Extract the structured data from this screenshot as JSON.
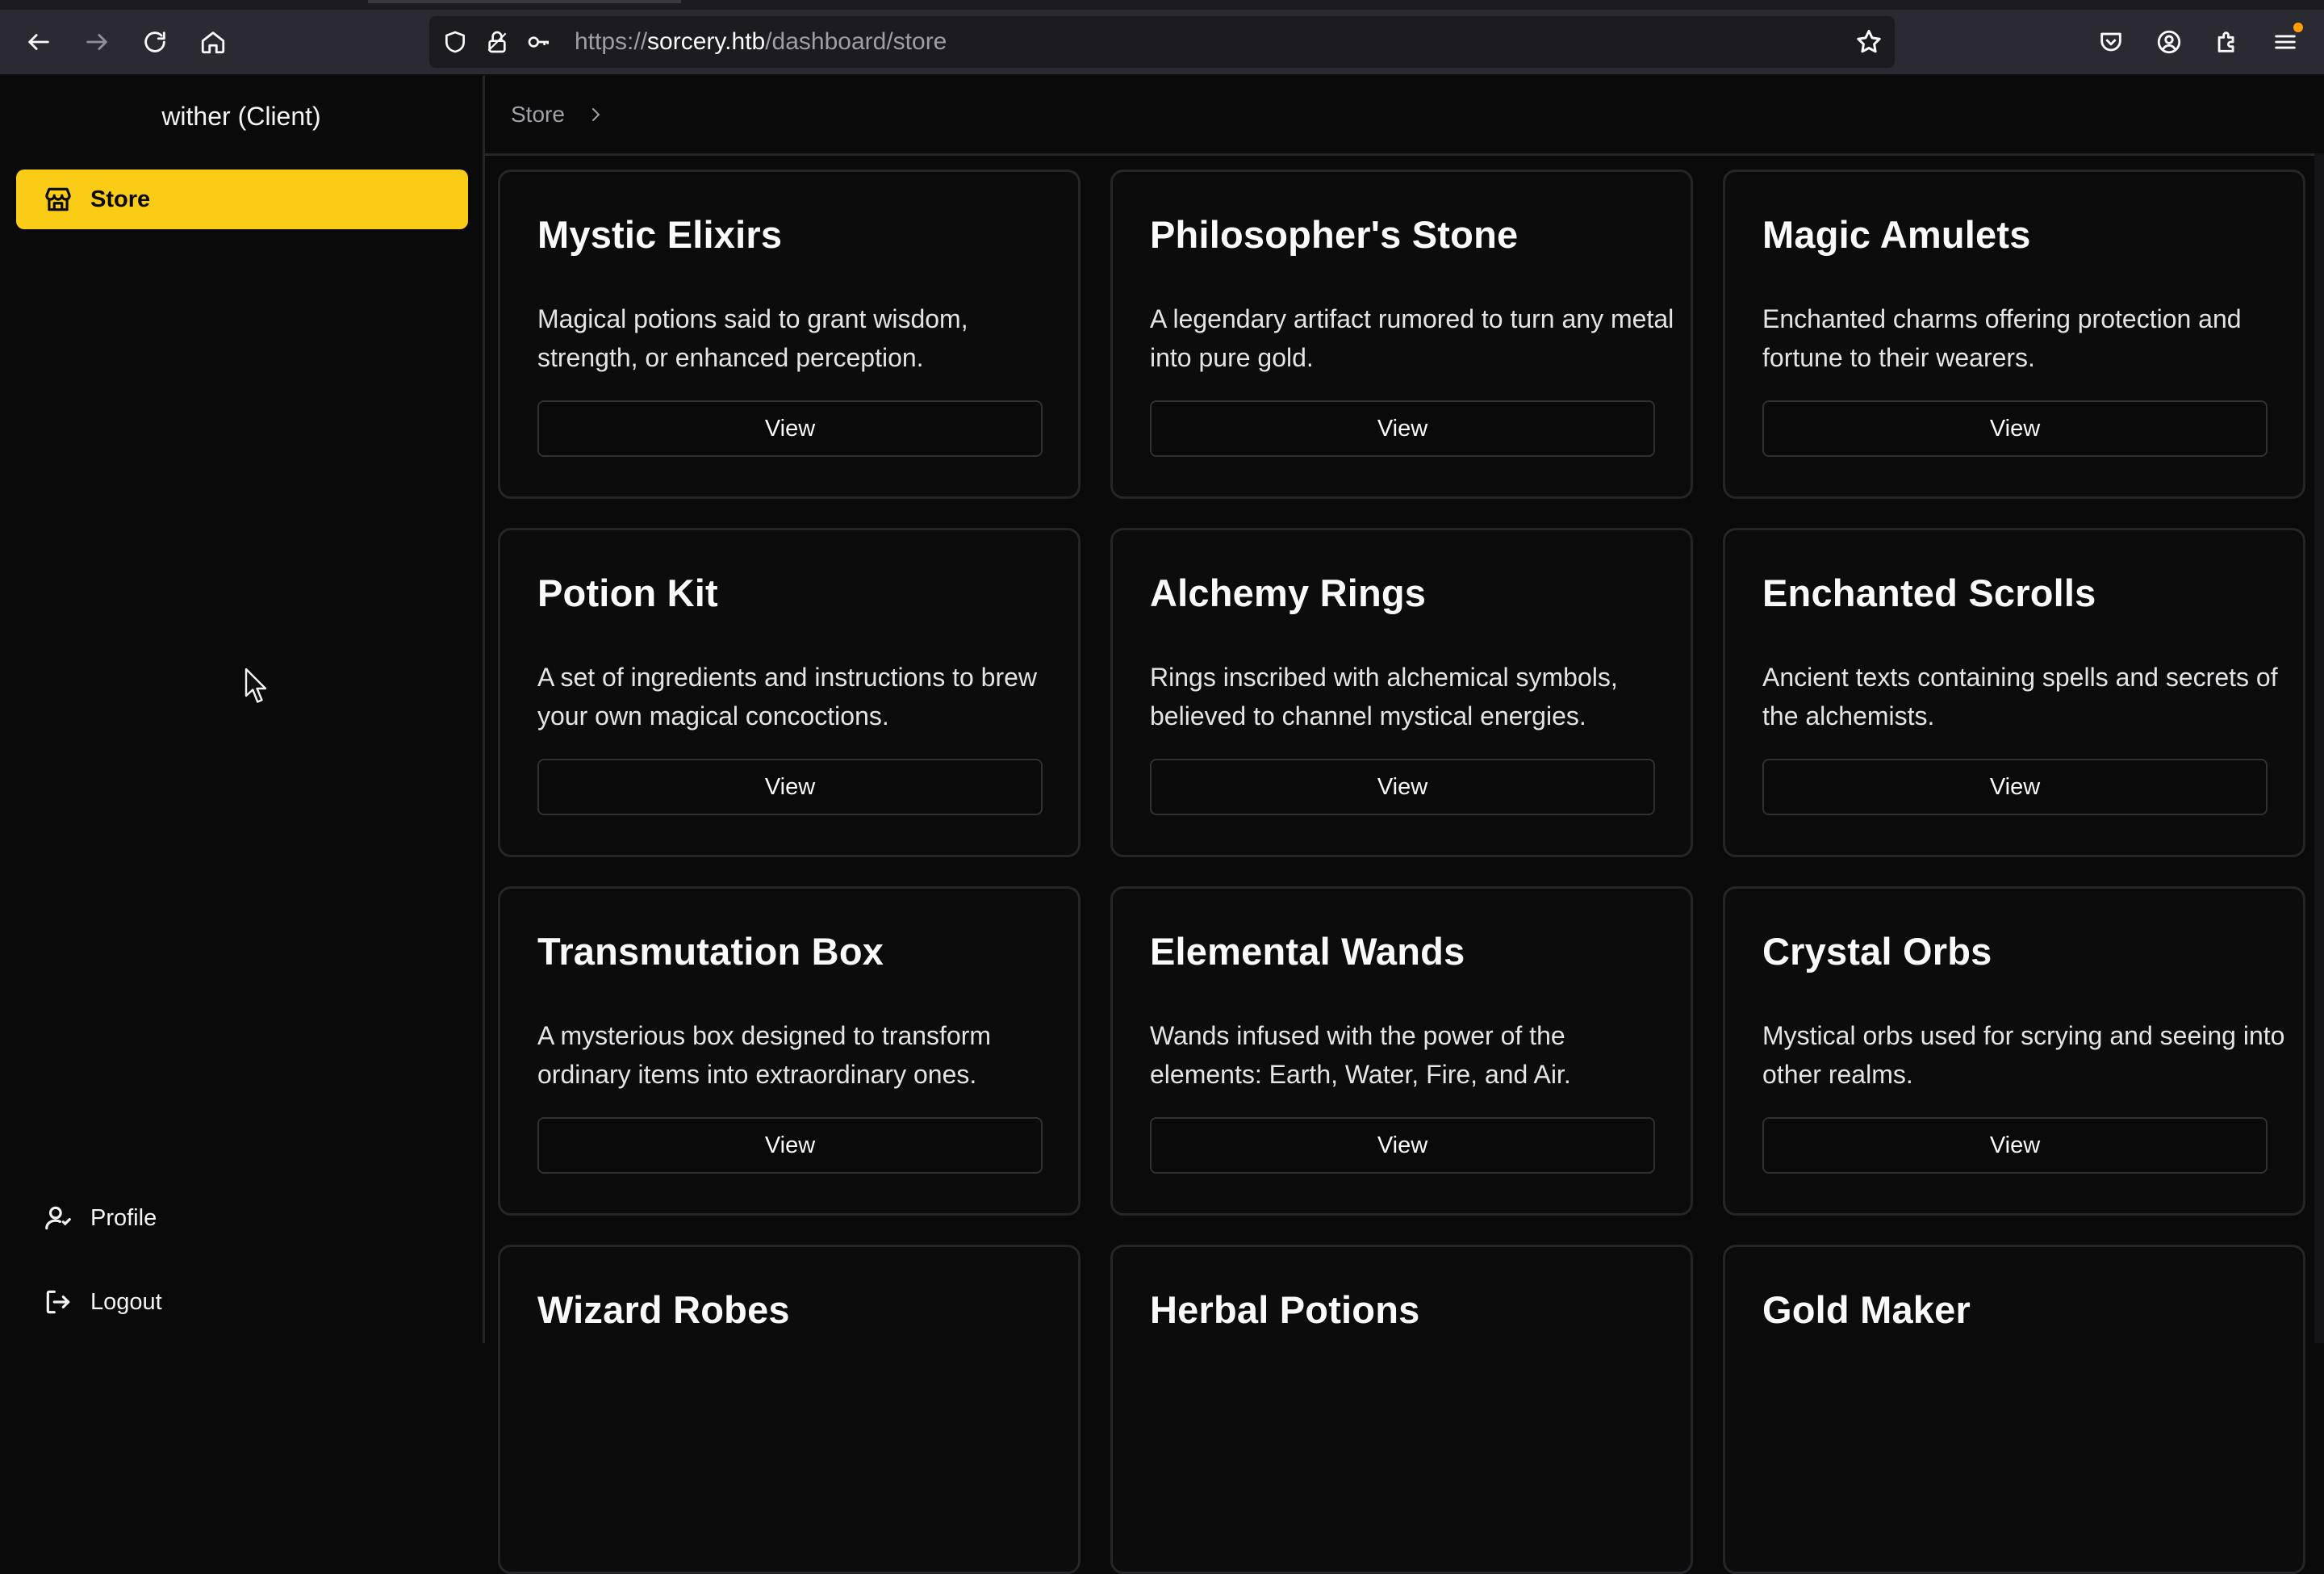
{
  "browser": {
    "url_scheme": "https://",
    "url_host": "sorcery.htb",
    "url_path": "/dashboard/store"
  },
  "sidebar": {
    "user_label": "wither (Client)",
    "nav_items": [
      {
        "label": "Store",
        "icon": "store-icon",
        "active": true
      }
    ],
    "footer_items": [
      {
        "label": "Profile",
        "icon": "user-icon"
      },
      {
        "label": "Logout",
        "icon": "logout-icon"
      }
    ]
  },
  "breadcrumb": {
    "current": "Store"
  },
  "colors": {
    "accent": "#facc15",
    "background": "#0a0a0a",
    "border": "#26262a"
  },
  "products": [
    {
      "title": "Mystic Elixirs",
      "description": "Magical potions said to grant wisdom, strength, or enhanced perception.",
      "button": "View"
    },
    {
      "title": "Philosopher's Stone",
      "description": "A legendary artifact rumored to turn any metal into pure gold.",
      "button": "View"
    },
    {
      "title": "Magic Amulets",
      "description": "Enchanted charms offering protection and fortune to their wearers.",
      "button": "View"
    },
    {
      "title": "Potion Kit",
      "description": "A set of ingredients and instructions to brew your own magical concoctions.",
      "button": "View"
    },
    {
      "title": "Alchemy Rings",
      "description": "Rings inscribed with alchemical symbols, believed to channel mystical energies.",
      "button": "View"
    },
    {
      "title": "Enchanted Scrolls",
      "description": "Ancient texts containing spells and secrets of the alchemists.",
      "button": "View"
    },
    {
      "title": "Transmutation Box",
      "description": "A mysterious box designed to transform ordinary items into extraordinary ones.",
      "button": "View"
    },
    {
      "title": "Elemental Wands",
      "description": "Wands infused with the power of the elements: Earth, Water, Fire, and Air.",
      "button": "View"
    },
    {
      "title": "Crystal Orbs",
      "description": "Mystical orbs used for scrying and seeing into other realms.",
      "button": "View"
    },
    {
      "title": "Wizard Robes",
      "description": "",
      "button": ""
    },
    {
      "title": "Herbal Potions",
      "description": "",
      "button": ""
    },
    {
      "title": "Gold Maker",
      "description": "",
      "button": ""
    }
  ]
}
